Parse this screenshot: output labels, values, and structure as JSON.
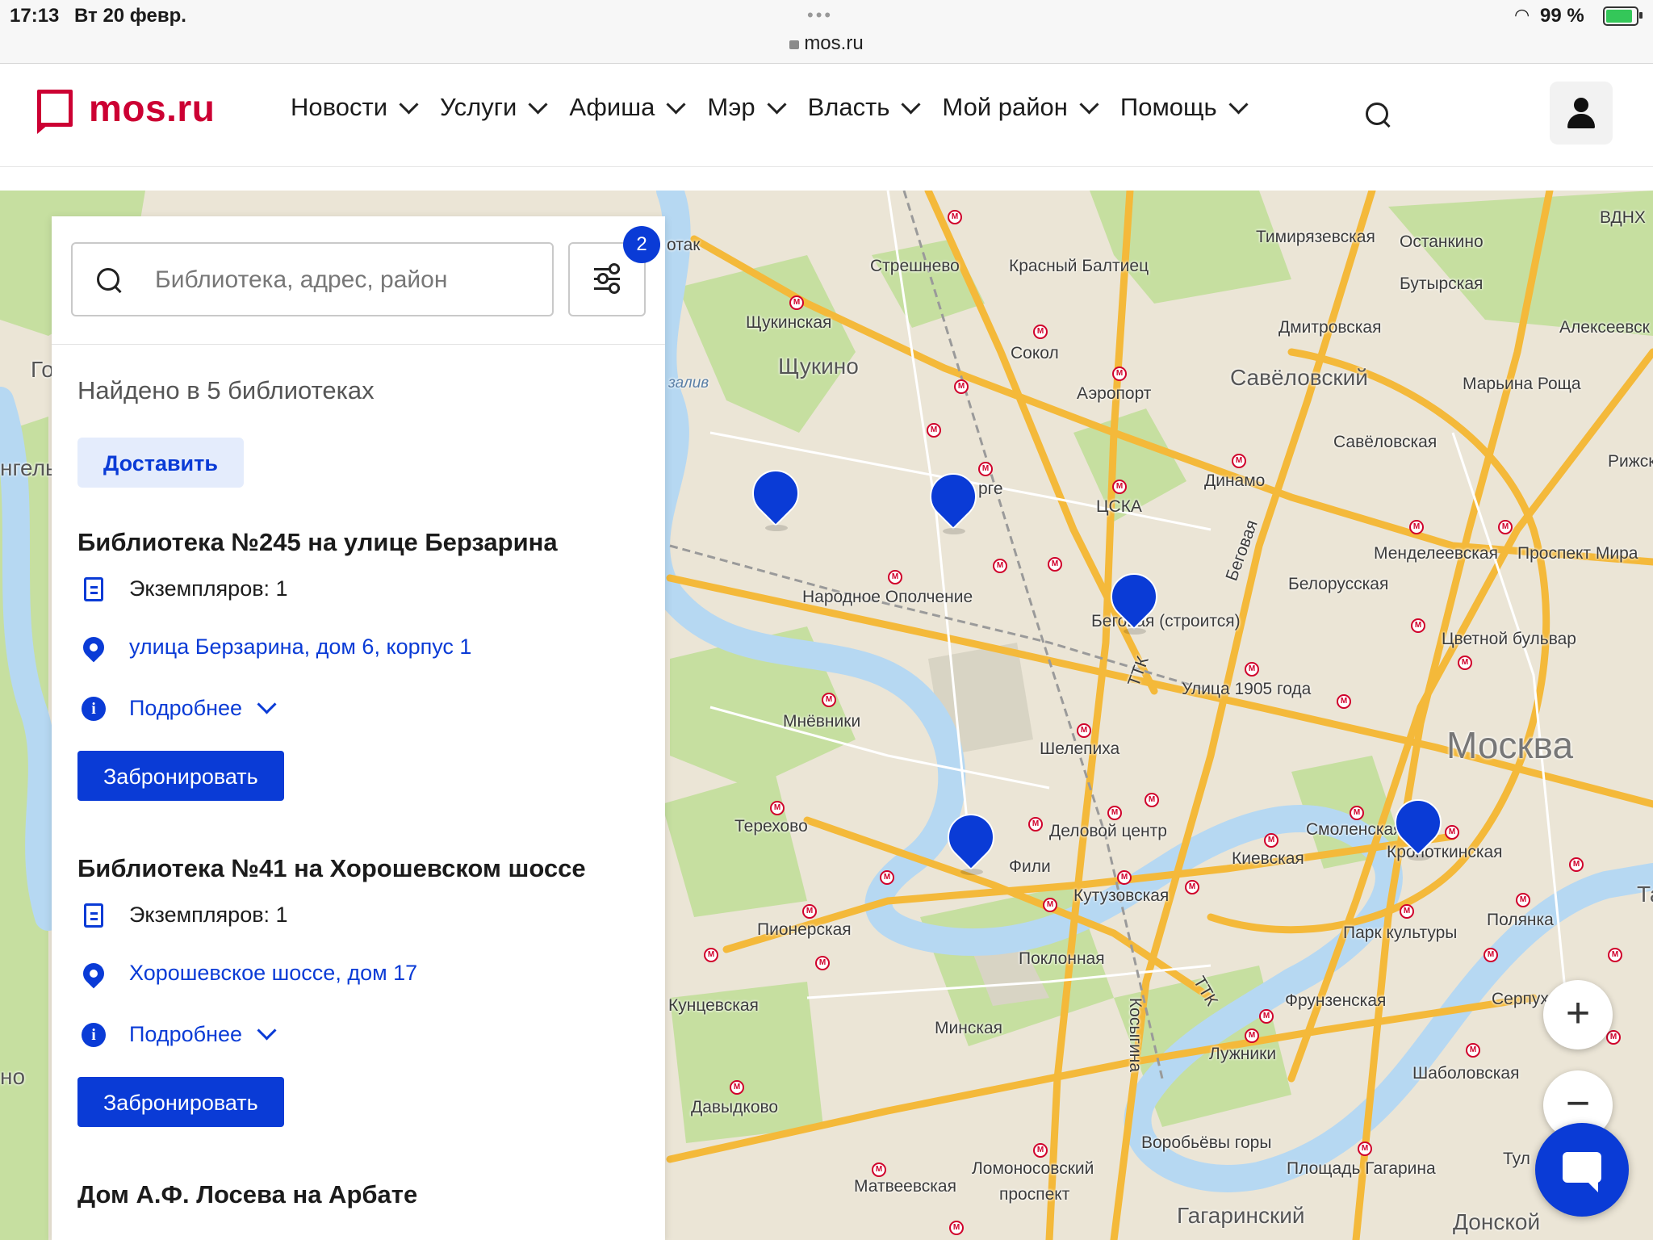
{
  "status_bar": {
    "time": "17:13",
    "date": "Вт 20 февр.",
    "url": "mos.ru",
    "battery": "99 %"
  },
  "header": {
    "logo": "mos.ru",
    "nav": [
      "Новости",
      "Услуги",
      "Афиша",
      "Мэр",
      "Власть",
      "Мой район",
      "Помощь"
    ]
  },
  "panel": {
    "search_placeholder": "Библиотека, адрес, район",
    "filter_count": "2",
    "found_text": "Найдено в 5 библиотеках",
    "deliver_label": "Доставить",
    "libraries": [
      {
        "title": "Библиотека №245 на улице Берзарина",
        "copies": "Экземпляров: 1",
        "address": "улица Берзарина, дом 6, корпус 1",
        "details": "Подробнее",
        "book": "Забронировать"
      },
      {
        "title": "Библиотека №41 на Хорошевском шоссе",
        "copies": "Экземпляров: 1",
        "address": "Хорошевское шоссе, дом 17",
        "details": "Подробнее",
        "book": "Забронировать"
      },
      {
        "title": "Дом А.Ф. Лосева на Арбате"
      }
    ]
  },
  "map": {
    "labels": {
      "streshnevo": "Стрешнево",
      "krasny_baltiets": "Красный Балтиец",
      "timiryazevskaya": "Тимирязевская",
      "ostankino": "Останкино",
      "vdnh": "ВДНХ",
      "butyrskaya": "Бутырская",
      "shchukinskaya": "Щукинская",
      "dmitrovskaya": "Дмитровская",
      "alekseevskaya": "Алексеевск",
      "shchukino": "Щукино",
      "sokol": "Сокол",
      "savelovsky": "Савёловский",
      "maryina_roshcha": "Марьина Роща",
      "aeroport": "Аэропорт",
      "zaliv": "залив",
      "savelovskaya": "Савёловская",
      "rizhskaya": "Рижска",
      "dinamo": "Динамо",
      "tsska": "ЦСКА",
      "pole": "рге",
      "begovaya_street": "Беговая",
      "mendeleevskaya": "Менделеевская",
      "prospekt_mira": "Проспект Мира",
      "narodnoe_opolchenie": "Народное Ополчение",
      "belorusskaya": "Белорусская",
      "begovaya": "Беговая (строится)",
      "tsvetnoy": "Цветной бульвар",
      "ttk1": "ТТК",
      "ulitsa_1905": "Улица 1905 года",
      "mnevniki": "Мнёвники",
      "moskva": "Москва",
      "shelepikha": "Шелепиха",
      "terekhovo": "Терехово",
      "delovoy": "Деловой центр",
      "smolenskaya": "Смоленская",
      "kropotkinskaya": "Кропоткинская",
      "fili": "Фили",
      "kievskaya": "Киевская",
      "kutuzovskaya": "Кутузовская",
      "polyanka": "Полянка",
      "pionerskaya": "Пионерская",
      "park_kultury": "Парк культуры",
      "poklonnaya": "Поклонная",
      "kuntsevskaya": "Кунцевская",
      "ttk2": "ТТК",
      "frunzenskaya": "Фрунзенская",
      "serpukhov": "Серпух",
      "minskaya": "Минская",
      "kosygina": "Косыгина",
      "luzhniki": "Лужники",
      "shabolovskaya": "Шаболовская",
      "davydkovo": "Давыдково",
      "vorobyovy": "Воробьёвы горы",
      "tula": "Тул",
      "lomonosovsky1": "Ломоносовский",
      "ploshchad_gagarina": "Площадь Гагарина",
      "matveevskaya": "Матвеевская",
      "lomonosovsky2": "проспект",
      "gagarinsky": "Гагаринский",
      "donskoy": "Донской",
      "go": "Го",
      "ngel": "нгель",
      "no": "но",
      "otak": "отак",
      "ta": "Та"
    }
  },
  "colors": {
    "brand_red": "#cc0033",
    "accent_blue": "#0a3bd6"
  }
}
